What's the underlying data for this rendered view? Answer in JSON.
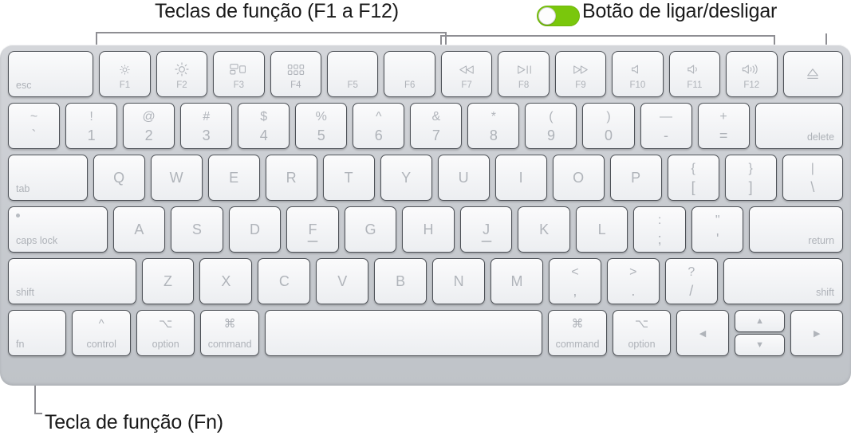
{
  "callouts": {
    "function_keys": "Teclas de função (F1 a F12)",
    "power_button": "Botão de ligar/desligar",
    "fn_key": "Tecla de função (Fn)",
    "toggle_color": "#7ac70c"
  },
  "keyboard": {
    "rows": {
      "function_row": [
        {
          "label": "esc",
          "fn": ""
        },
        {
          "icon": "brightness-down-icon",
          "fn": "F1"
        },
        {
          "icon": "brightness-up-icon",
          "fn": "F2"
        },
        {
          "icon": "mission-control-icon",
          "fn": "F3"
        },
        {
          "icon": "launchpad-icon",
          "fn": "F4"
        },
        {
          "icon": "",
          "fn": "F5"
        },
        {
          "icon": "",
          "fn": "F6"
        },
        {
          "icon": "rewind-icon",
          "fn": "F7"
        },
        {
          "icon": "play-pause-icon",
          "fn": "F8"
        },
        {
          "icon": "fast-forward-icon",
          "fn": "F9"
        },
        {
          "icon": "mute-icon",
          "fn": "F10"
        },
        {
          "icon": "volume-down-icon",
          "fn": "F11"
        },
        {
          "icon": "volume-up-icon",
          "fn": "F12"
        },
        {
          "icon": "eject-icon",
          "fn": ""
        }
      ],
      "number_row": [
        {
          "top": "~",
          "bottom": "`"
        },
        {
          "top": "!",
          "bottom": "1"
        },
        {
          "top": "@",
          "bottom": "2"
        },
        {
          "top": "#",
          "bottom": "3"
        },
        {
          "top": "$",
          "bottom": "4"
        },
        {
          "top": "%",
          "bottom": "5"
        },
        {
          "top": "^",
          "bottom": "6"
        },
        {
          "top": "&",
          "bottom": "7"
        },
        {
          "top": "*",
          "bottom": "8"
        },
        {
          "top": "(",
          "bottom": "9"
        },
        {
          "top": ")",
          "bottom": "0"
        },
        {
          "top": "—",
          "bottom": "-"
        },
        {
          "top": "+",
          "bottom": "="
        },
        {
          "word": "delete"
        }
      ],
      "qwerty_row": [
        {
          "word": "tab"
        },
        {
          "letter": "Q"
        },
        {
          "letter": "W"
        },
        {
          "letter": "E"
        },
        {
          "letter": "R"
        },
        {
          "letter": "T"
        },
        {
          "letter": "Y"
        },
        {
          "letter": "U"
        },
        {
          "letter": "I"
        },
        {
          "letter": "O"
        },
        {
          "letter": "P"
        },
        {
          "top": "{",
          "bottom": "["
        },
        {
          "top": "}",
          "bottom": "]"
        },
        {
          "top": "|",
          "bottom": "\\"
        }
      ],
      "home_row": [
        {
          "word": "caps lock"
        },
        {
          "letter": "A"
        },
        {
          "letter": "S"
        },
        {
          "letter": "D"
        },
        {
          "letter": "F",
          "homing": true
        },
        {
          "letter": "G"
        },
        {
          "letter": "H"
        },
        {
          "letter": "J",
          "homing": true
        },
        {
          "letter": "K"
        },
        {
          "letter": "L"
        },
        {
          "top": ":",
          "bottom": ";"
        },
        {
          "top": "\"",
          "bottom": "'"
        },
        {
          "word": "return"
        }
      ],
      "shift_row": [
        {
          "word": "shift"
        },
        {
          "letter": "Z"
        },
        {
          "letter": "X"
        },
        {
          "letter": "C"
        },
        {
          "letter": "V"
        },
        {
          "letter": "B"
        },
        {
          "letter": "N"
        },
        {
          "letter": "M"
        },
        {
          "top": "<",
          "bottom": ","
        },
        {
          "top": ">",
          "bottom": "."
        },
        {
          "top": "?",
          "bottom": "/"
        },
        {
          "word": "shift"
        }
      ],
      "modifier_row": [
        {
          "sym": "",
          "word": "fn"
        },
        {
          "sym": "^",
          "word": "control"
        },
        {
          "sym": "⌥",
          "word": "option"
        },
        {
          "sym": "⌘",
          "word": "command"
        },
        {
          "sym": "",
          "word": ""
        },
        {
          "sym": "⌘",
          "word": "command"
        },
        {
          "sym": "⌥",
          "word": "option"
        },
        {
          "arrow": "◀"
        },
        {
          "arrow_up": "▲",
          "arrow_down": "▼"
        },
        {
          "arrow": "▶"
        }
      ]
    }
  }
}
